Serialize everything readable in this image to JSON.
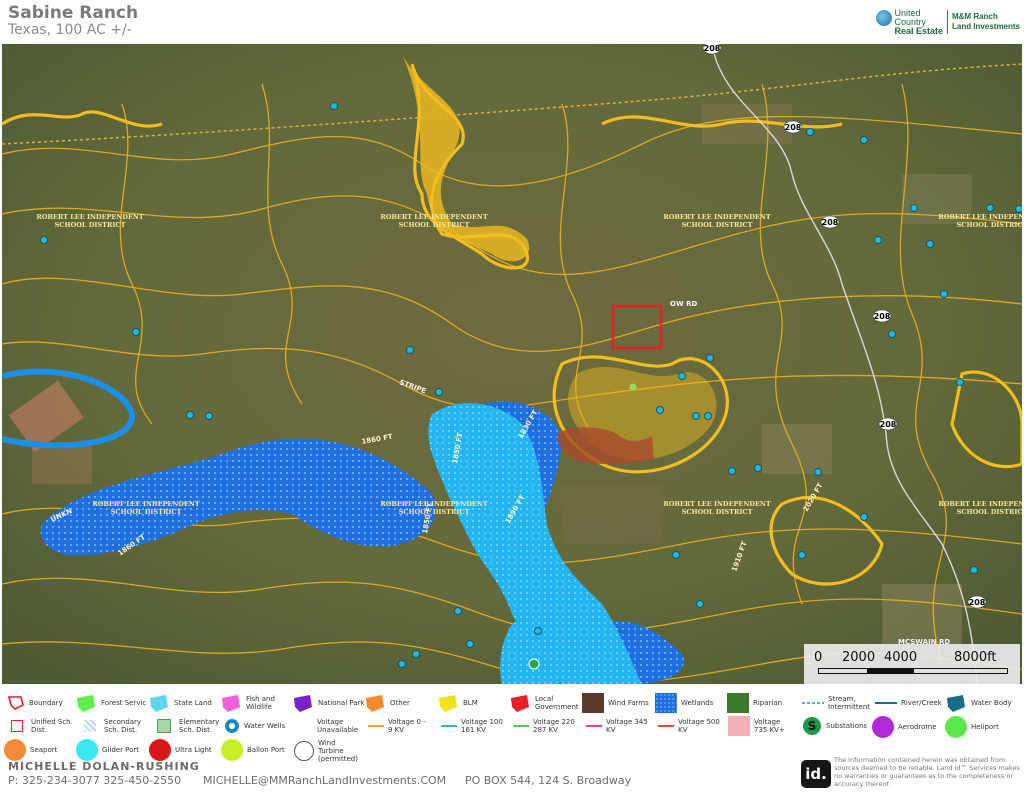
{
  "header": {
    "title": "Sabine Ranch",
    "subtitle": "Texas, 100 AC +/-",
    "logo_brand_line1": "United",
    "logo_brand_line2": "Country",
    "logo_brand_line3": "Real Estate",
    "logo_partner_line1": "M&M Ranch",
    "logo_partner_line2": "Land Investments"
  },
  "map": {
    "district_labels": [
      "ROBERT LEE INDEPENDENT",
      "SCHOOL DISTRICT"
    ],
    "road_labels": [
      "208",
      "208",
      "208",
      "208",
      "208",
      "208"
    ],
    "road_names": [
      "STRIPE",
      "OW RD",
      "MCSWAIN RD",
      "UNKN"
    ],
    "contour_labels": [
      "1860 FT",
      "1850 FT",
      "1850 FT",
      "1830 FT",
      "1890 FT",
      "1860 FT",
      "2020 FT",
      "1910 FT"
    ],
    "colors": {
      "boundary": "#e8202a",
      "blm": "#f1b81e",
      "wetlands": "#1f6fe0",
      "lake_light": "#1cb8f0",
      "imagery": "#5e6a3a"
    }
  },
  "scale": {
    "labels": [
      "0",
      "2000",
      "4000",
      "8000ft"
    ]
  },
  "legend": {
    "items": [
      {
        "label": "Boundary",
        "icon": "boundary-swatch"
      },
      {
        "label": "Forest Servic",
        "icon": "forest-service-swatch"
      },
      {
        "label": "State Land",
        "icon": "state-land-swatch"
      },
      {
        "label": "Fish and Wildlife",
        "icon": "fish-wildlife-swatch"
      },
      {
        "label": "National Park",
        "icon": "national-park-swatch"
      },
      {
        "label": "Other",
        "icon": "other-swatch"
      },
      {
        "label": "BLM",
        "icon": "blm-swatch"
      },
      {
        "label": "Local Government",
        "icon": "local-government-swatch"
      },
      {
        "label": "Wind Farms",
        "icon": "wind-farms-swatch"
      },
      {
        "label": "Wetlands",
        "icon": "wetlands-swatch"
      },
      {
        "label": "Riparian",
        "icon": "riparian-swatch"
      },
      {
        "label": "Stream, Intermittent",
        "icon": "stream-intermittent-swatch"
      },
      {
        "label": "River/Creek",
        "icon": "river-creek-swatch"
      },
      {
        "label": "Water Body",
        "icon": "water-body-swatch"
      },
      {
        "label": "Unified Sch. Dist.",
        "icon": "unified-school-swatch"
      },
      {
        "label": "Secondary Sch. Dist.",
        "icon": "secondary-school-swatch"
      },
      {
        "label": "Elementary Sch. Dist.",
        "icon": "elementary-school-swatch"
      },
      {
        "label": "Water Wells",
        "icon": "water-well-icon"
      },
      {
        "label": "Voltage Unavailable",
        "icon": "voltage-unavailable-swatch"
      },
      {
        "label": "Voltage 0 - 9 KV",
        "icon": "voltage-0-9-swatch"
      },
      {
        "label": "Voltage 100 161 KV",
        "icon": "voltage-100-161-swatch"
      },
      {
        "label": "Voltage 220 287 KV",
        "icon": "voltage-220-287-swatch"
      },
      {
        "label": "Voltage 345 KV",
        "icon": "voltage-345-swatch"
      },
      {
        "label": "Voltage 500 KV",
        "icon": "voltage-500-swatch"
      },
      {
        "label": "Voltage 735 KV+",
        "icon": "voltage-735-swatch"
      },
      {
        "label": "Substations",
        "icon": "substation-icon"
      },
      {
        "label": "Aerodrome",
        "icon": "aerodrome-icon"
      },
      {
        "label": "Heliport",
        "icon": "heliport-icon"
      },
      {
        "label": "Seaport",
        "icon": "seaport-icon"
      },
      {
        "label": "Glider Port",
        "icon": "glider-port-icon"
      },
      {
        "label": "Ultra Light",
        "icon": "ultra-light-icon"
      },
      {
        "label": "Ballon Port",
        "icon": "balloon-port-icon"
      },
      {
        "label": "Wind Turbine (permitted)",
        "icon": "wind-turbine-icon"
      }
    ]
  },
  "footer": {
    "agent": "MICHELLE  DOLAN-RUSHING",
    "phone": "P: 325-234-3077 325-450-2550",
    "email": "MICHELLE@MMRanchLandInvestments.COM",
    "address": "PO BOX 544, 124 S. Broadway",
    "id_logo": "id.",
    "disclaimer": "The information contained herein was obtained from sources deemed to be reliable. Land id™ Services makes no warranties or guarantees as to the completeness or accuracy thereof."
  }
}
